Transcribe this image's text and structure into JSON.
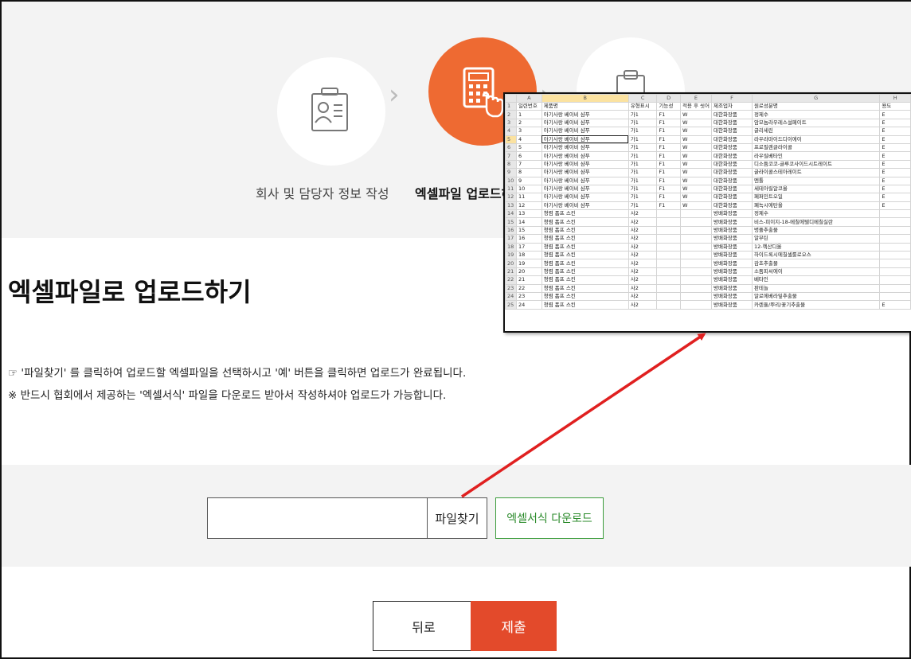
{
  "steps": [
    {
      "label": "회사 및 담당자 정보 작성",
      "icon": "id-card-icon"
    },
    {
      "label": "엑셀파일 업로드하기",
      "icon": "calculator-click-icon"
    },
    {
      "label": "",
      "icon": "clipboard-icon"
    }
  ],
  "chevron": "›",
  "heading": "엑셀파일로 업로드하기",
  "notes": [
    "☞ '파일찾기' 를 클릭하여 업로드할 엑셀파일을 선택하시고 '예' 버튼을 클릭하면 업로드가 완료됩니다.",
    "※ 반드시 협회에서 제공하는 '엑셀서식' 파일을 다운로드 받아서 작성하셔야 업로드가 가능합니다."
  ],
  "upload": {
    "file_value": "",
    "find_label": "파일찾기",
    "template_label": "엑셀서식 다운로드"
  },
  "buttons": {
    "back": "뒤로",
    "submit": "제출"
  },
  "colors": {
    "accent": "#ee6a32",
    "submit": "#e34a2b",
    "green": "#3a9b3a",
    "arrow": "#e02020"
  },
  "spreadsheet": {
    "columns": [
      "A",
      "B",
      "C",
      "D",
      "E",
      "F",
      "G",
      "H"
    ],
    "header": [
      "일련번호",
      "제품명",
      "유형표시",
      "기능성",
      "적용 후 씻어",
      "제조업자",
      "원료성분명",
      "용도"
    ],
    "rows": [
      [
        "1",
        "아기사랑 베이비 샴푸",
        "가1",
        "F1",
        "W",
        "대한화장품",
        "정제수",
        "E"
      ],
      [
        "2",
        "아기사랑 베이비 샴푸",
        "가1",
        "F1",
        "W",
        "대한화장품",
        "암모늄라우레스설페이트",
        "E"
      ],
      [
        "3",
        "아기사랑 베이비 샴푸",
        "가1",
        "F1",
        "W",
        "대한화장품",
        "글리세린",
        "E"
      ],
      [
        "4",
        "아기사랑 베이비 샴푸",
        "가1",
        "F1",
        "W",
        "대한화장품",
        "라우라마이드디이에이",
        "E"
      ],
      [
        "5",
        "아기사랑 베이비 샴푸",
        "가1",
        "F1",
        "W",
        "대한화장품",
        "프로필렌글라이콜",
        "E"
      ],
      [
        "6",
        "아기사랑 베이비 샴푸",
        "가1",
        "F1",
        "W",
        "대한화장품",
        "라우릴베타인",
        "E"
      ],
      [
        "7",
        "아기사랑 베이비 샴푸",
        "가1",
        "F1",
        "W",
        "대한화장품",
        "디소듐코코-글루코사이드시트레이트",
        "E"
      ],
      [
        "8",
        "아기사랑 베이비 샴푸",
        "가1",
        "F1",
        "W",
        "대한화장품",
        "글라이콜스테아레이트",
        "E"
      ],
      [
        "9",
        "아기사랑 베이비 샴푸",
        "가1",
        "F1",
        "W",
        "대한화장품",
        "멘톨",
        "E"
      ],
      [
        "10",
        "아기사랑 베이비 샴푸",
        "가1",
        "F1",
        "W",
        "대한화장품",
        "세테아릴알코올",
        "E"
      ],
      [
        "11",
        "아기사랑 베이비 샴푸",
        "가1",
        "F1",
        "W",
        "대한화장품",
        "페퍼민트오일",
        "E"
      ],
      [
        "12",
        "아기사랑 베이비 샴푸",
        "가1",
        "F1",
        "W",
        "대한화장품",
        "폐녹시에탄올",
        "E"
      ],
      [
        "13",
        "청렴 폼프 스킨",
        "사2",
        "",
        "",
        "방배화장품",
        "정제수",
        ""
      ],
      [
        "14",
        "청렴 폼프 스킨",
        "사2",
        "",
        "",
        "방배화장품",
        "비스-피이지-18-메칠에텔디메칠실란",
        ""
      ],
      [
        "15",
        "청렴 폼프 스킨",
        "사2",
        "",
        "",
        "방배화장품",
        "병풀추출물",
        ""
      ],
      [
        "16",
        "청렴 폼프 스킨",
        "사2",
        "",
        "",
        "방배화장품",
        "알부틴",
        ""
      ],
      [
        "17",
        "청렴 폼프 스킨",
        "사2",
        "",
        "",
        "방배화장품",
        "12-헥산디올",
        ""
      ],
      [
        "18",
        "청렴 폼프 스킨",
        "사2",
        "",
        "",
        "방배화장품",
        "하이드록시에칠셀룰로오스",
        ""
      ],
      [
        "19",
        "청렴 폼프 스킨",
        "사2",
        "",
        "",
        "방배화장품",
        "감초추출물",
        ""
      ],
      [
        "20",
        "청렴 폼프 스킨",
        "사2",
        "",
        "",
        "방배화장품",
        "소듐피씨에이",
        ""
      ],
      [
        "21",
        "청렴 폼프 스킨",
        "사2",
        "",
        "",
        "방배화장품",
        "베타인",
        ""
      ],
      [
        "22",
        "청렴 폼프 스킨",
        "사2",
        "",
        "",
        "방배화장품",
        "판테놀",
        ""
      ],
      [
        "23",
        "청렴 폼프 스킨",
        "사2",
        "",
        "",
        "방배화장품",
        "알로에베라잎추출물",
        ""
      ],
      [
        "24",
        "청렴 폼프 스킨",
        "사2",
        "",
        "",
        "방배화장품",
        "카렌듈/뿌리/꽃기추출물",
        "E"
      ]
    ]
  }
}
